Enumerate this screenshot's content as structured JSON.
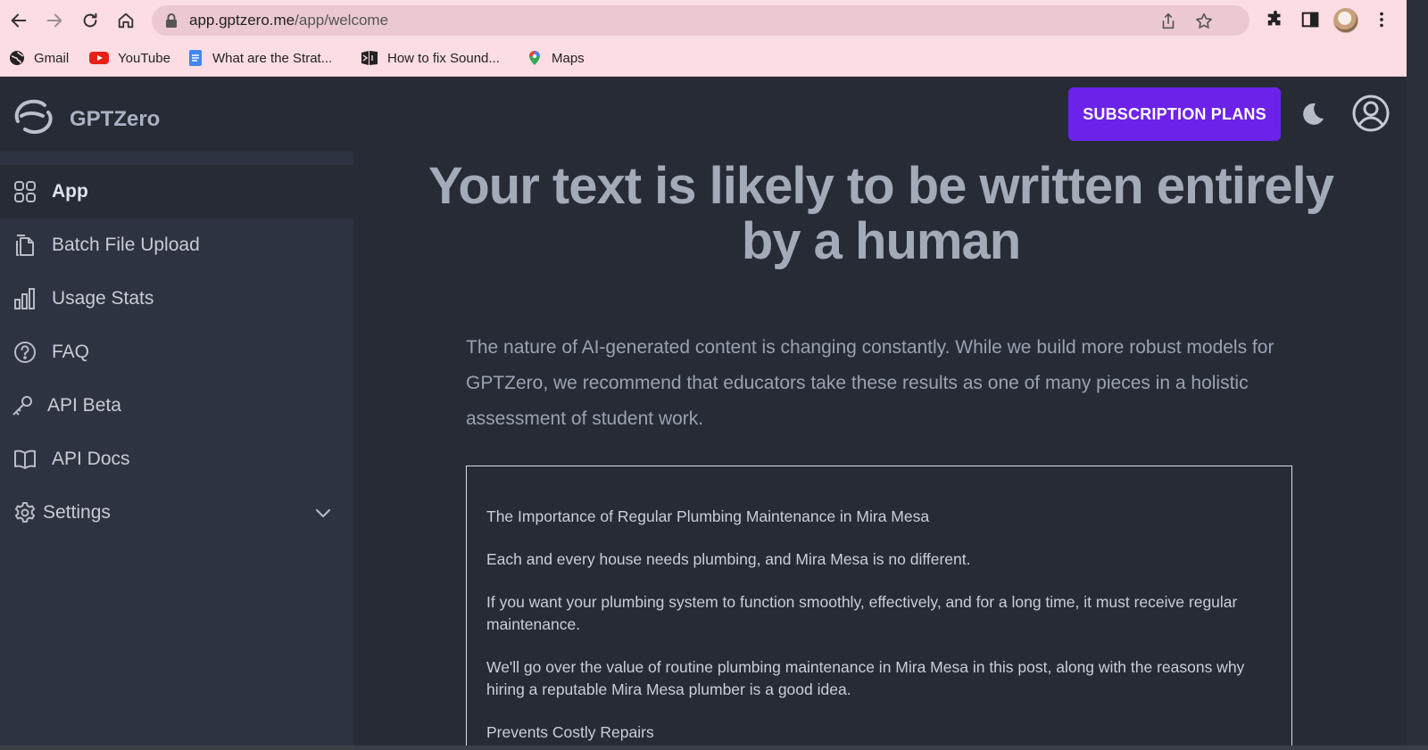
{
  "browser": {
    "url_host": "app.gptzero.me",
    "url_path": "/app/welcome",
    "bookmarks": [
      {
        "label": "Gmail",
        "icon": "globe-icon"
      },
      {
        "label": "YouTube",
        "icon": "youtube-icon"
      },
      {
        "label": "What are the Strat...",
        "icon": "docs-icon"
      },
      {
        "label": "How to fix Sound...",
        "icon": "windows-icon"
      },
      {
        "label": "Maps",
        "icon": "maps-icon"
      }
    ]
  },
  "header": {
    "brand": "GPTZero",
    "subscription_label": "SUBSCRIPTION PLANS",
    "accent_color": "#6d22ea"
  },
  "sidebar": {
    "items": [
      {
        "label": "App",
        "icon": "grid-icon",
        "active": true
      },
      {
        "label": "Batch File Upload",
        "icon": "files-icon"
      },
      {
        "label": "Usage Stats",
        "icon": "bar-chart-icon"
      },
      {
        "label": "FAQ",
        "icon": "help-circle-icon"
      },
      {
        "label": "API Beta",
        "icon": "key-icon"
      },
      {
        "label": "API Docs",
        "icon": "book-icon"
      },
      {
        "label": "Settings",
        "icon": "gear-icon",
        "expandable": true
      }
    ]
  },
  "main": {
    "headline": "Your text is likely to be written entirely by a human",
    "note": "The nature of AI-generated content is changing constantly. While we build more robust models for GPTZero, we recommend that educators take these results as one of many pieces in a holistic assessment of student work.",
    "text_paragraphs": [
      "The Importance of Regular Plumbing Maintenance in Mira Mesa",
      "Each and every house needs plumbing, and Mira Mesa is no different.",
      "If you want your plumbing system to function smoothly, effectively, and for a long time, it must receive regular maintenance.",
      "We'll go over the value of routine plumbing maintenance in Mira Mesa in this post, along with the reasons why hiring a reputable Mira Mesa plumber is a good idea.",
      "Prevents Costly Repairs"
    ]
  }
}
